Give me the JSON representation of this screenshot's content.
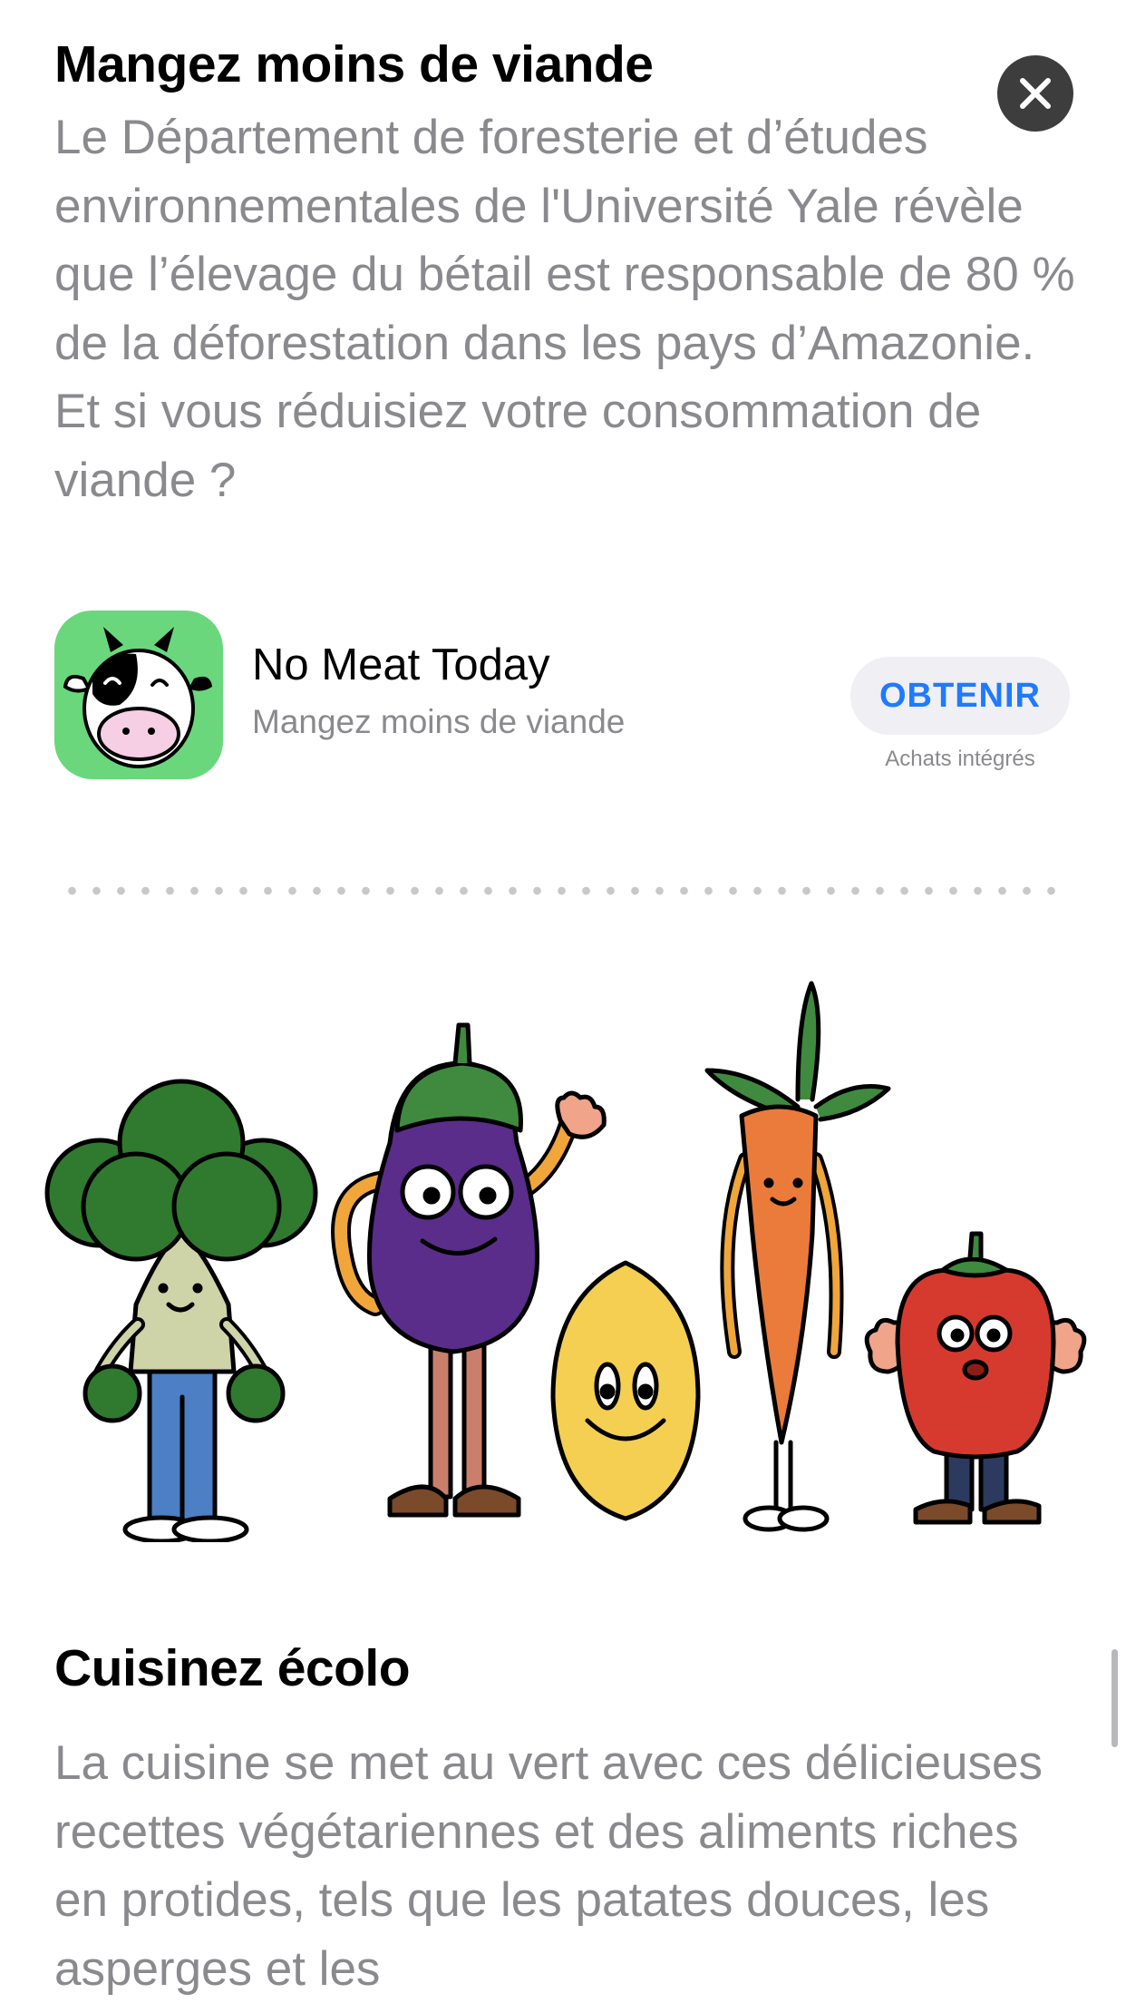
{
  "section1": {
    "title": "Mangez moins de viande",
    "body": "Le Département de foresterie et d’études environnementales de l'Université Yale révèle que l’élevage du bétail est responsable de 80 % de la déforestation dans les pays d’Amazonie. Et si vous réduisiez votre consommation de viande ?"
  },
  "close_icon": "close-icon",
  "app": {
    "icon": "cow-face-icon",
    "name": "No Meat Today",
    "subtitle": "Mangez moins de viande",
    "get_label": "OBTENIR",
    "in_app_purchases": "Achats intégrés",
    "icon_color": "#6ad77d",
    "button_text_color": "#1f7aff"
  },
  "illustration": {
    "characters": [
      "broccoli",
      "eggplant",
      "lemon",
      "carrot",
      "bell-pepper"
    ]
  },
  "section2": {
    "title": "Cuisinez écolo",
    "body": "La cuisine se met au vert avec ces délicieuses recettes végétariennes et des aliments riches en protides, tels que les patates douces, les asperges et les"
  }
}
